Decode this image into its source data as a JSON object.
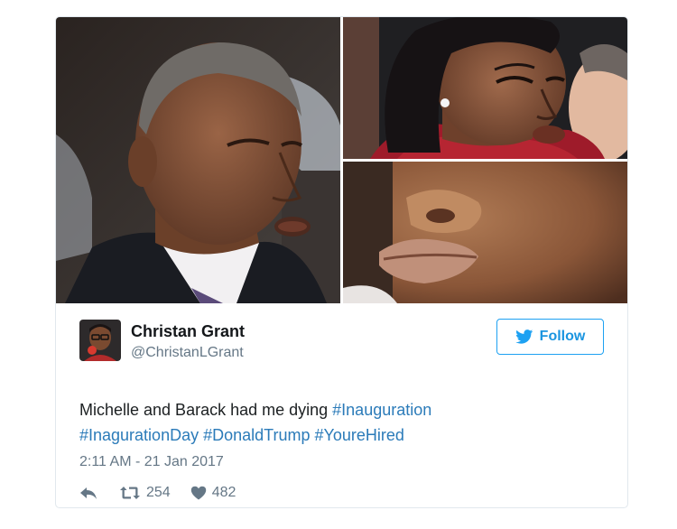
{
  "tweet": {
    "author": {
      "display_name": "Christan Grant",
      "handle": "@ChristanLGrant",
      "avatar_icon": "user-avatar"
    },
    "follow_label": "Follow",
    "follow_icon": "twitter-bird-icon",
    "text": {
      "plain": "Michelle and Barack had me dying ",
      "hashtags": [
        "#Inauguration",
        "#InagurationDay",
        "#DonaldTrump",
        "#YoureHired"
      ]
    },
    "timestamp": "2:11 AM - 21 Jan 2017",
    "actions": {
      "reply_icon": "reply-icon",
      "retweet_icon": "retweet-icon",
      "retweet_count": "254",
      "like_icon": "heart-icon",
      "like_count": "482"
    }
  },
  "colors": {
    "link": "#2b7bb9",
    "follow_blue": "#1da1f2",
    "muted": "#657786",
    "border": "#e1e8ed"
  }
}
